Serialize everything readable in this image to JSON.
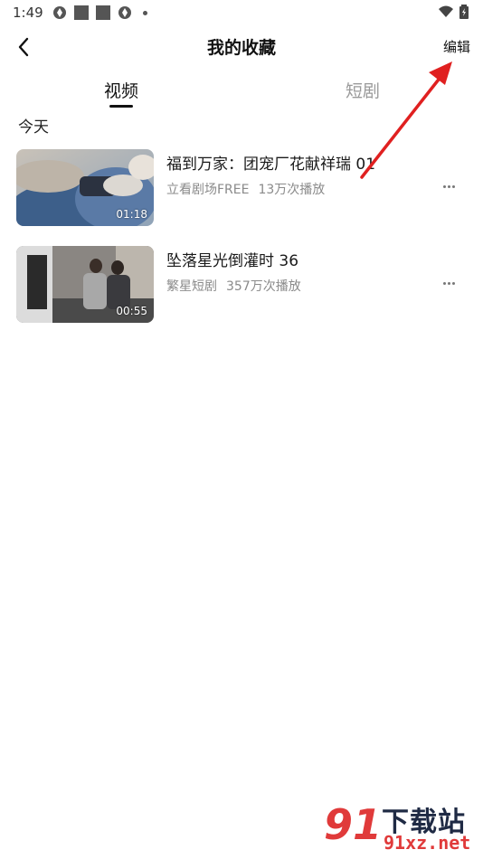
{
  "status_bar": {
    "time": "1:49"
  },
  "header": {
    "title": "我的收藏",
    "edit_label": "编辑"
  },
  "tabs": [
    {
      "label": "视频",
      "active": true
    },
    {
      "label": "短剧",
      "active": false
    }
  ],
  "section_label": "今天",
  "items": [
    {
      "title": "福到万家：团宠厂花献祥瑞 01",
      "source": "立看剧场FREE",
      "plays": "13万次播放",
      "duration": "01:18"
    },
    {
      "title": "坠落星光倒灌时 36",
      "source": "繁星短剧",
      "plays": "357万次播放",
      "duration": "00:55"
    }
  ],
  "watermark": {
    "mark": "91",
    "title": "下载站",
    "domain": "91xz.net"
  },
  "colors": {
    "accent_arrow": "#e02020",
    "watermark_red": "#e03a3a",
    "meta_gray": "#8a8a8a"
  }
}
